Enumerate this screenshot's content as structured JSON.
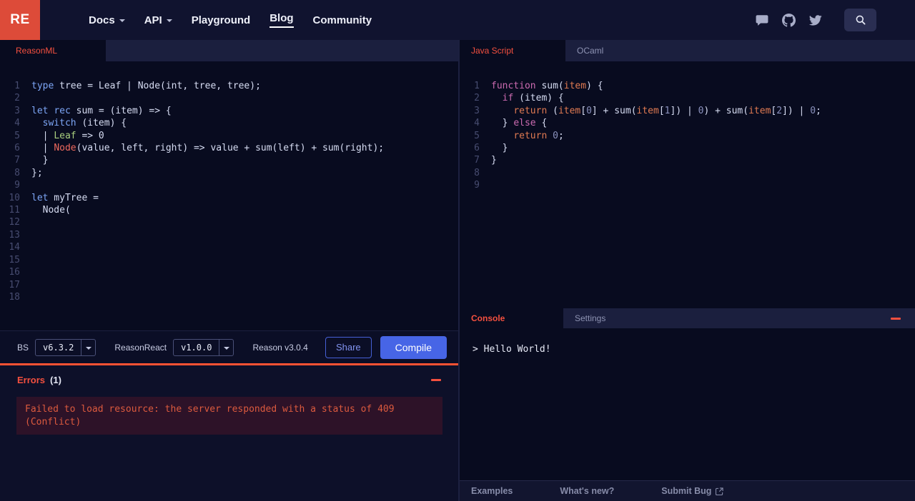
{
  "colors": {
    "accent_red": "#f4503f",
    "accent_blue": "#4765e6",
    "logo_red": "#dd4b39",
    "error_divider": "#ff5233"
  },
  "navbar": {
    "logo_text": "RE",
    "items": [
      {
        "label": "Docs",
        "caret": true
      },
      {
        "label": "API",
        "caret": true
      },
      {
        "label": "Playground",
        "caret": false
      },
      {
        "label": "Blog",
        "caret": false,
        "active": true
      },
      {
        "label": "Community",
        "caret": false
      }
    ],
    "icons": [
      "chat",
      "github",
      "twitter",
      "search"
    ]
  },
  "reason_editor": {
    "tab_label": "ReasonML",
    "code": [
      {
        "n": "1",
        "t": [
          [
            "k",
            "type"
          ],
          [
            "d",
            " tree = Leaf | Node(int, tree, tree);"
          ]
        ]
      },
      {
        "n": "2",
        "t": []
      },
      {
        "n": "3",
        "t": [
          [
            "k",
            "let"
          ],
          [
            "d",
            " "
          ],
          [
            "k",
            "rec"
          ],
          [
            "d",
            " sum = (item) => {"
          ]
        ]
      },
      {
        "n": "4",
        "t": [
          [
            "d",
            "  "
          ],
          [
            "k",
            "switch"
          ],
          [
            "d",
            " (item) {"
          ]
        ]
      },
      {
        "n": "5",
        "t": [
          [
            "d",
            "  | "
          ],
          [
            "g",
            "Leaf"
          ],
          [
            "d",
            " => 0"
          ]
        ]
      },
      {
        "n": "6",
        "t": [
          [
            "d",
            "  | "
          ],
          [
            "r",
            "Node"
          ],
          [
            "d",
            "(value, left, right) => value + sum(left) + sum(right);"
          ]
        ]
      },
      {
        "n": "7",
        "t": [
          [
            "d",
            "  }"
          ]
        ]
      },
      {
        "n": "8",
        "t": [
          [
            "d",
            "};"
          ]
        ]
      },
      {
        "n": "9",
        "t": []
      },
      {
        "n": "10",
        "t": [
          [
            "k",
            "let"
          ],
          [
            "d",
            " myTree ="
          ]
        ]
      },
      {
        "n": "11",
        "t": [
          [
            "d",
            "  Node("
          ]
        ]
      },
      {
        "n": "12",
        "t": []
      },
      {
        "n": "13",
        "t": []
      },
      {
        "n": "14",
        "t": []
      },
      {
        "n": "15",
        "t": []
      },
      {
        "n": "16",
        "t": []
      },
      {
        "n": "17",
        "t": []
      },
      {
        "n": "18",
        "t": []
      }
    ]
  },
  "js_editor": {
    "tabs": [
      {
        "label": "Java Script",
        "active": true
      },
      {
        "label": "OCaml",
        "active": false
      }
    ],
    "code": [
      {
        "n": "1",
        "t": [
          [
            "p",
            "function"
          ],
          [
            "d",
            " sum("
          ],
          [
            "o",
            "item"
          ],
          [
            "d",
            ") {"
          ]
        ]
      },
      {
        "n": "2",
        "t": [
          [
            "d",
            "  "
          ],
          [
            "p",
            "if"
          ],
          [
            "d",
            " (item) {"
          ]
        ]
      },
      {
        "n": "3",
        "t": [
          [
            "d",
            "    "
          ],
          [
            "o",
            "return"
          ],
          [
            "d",
            " ("
          ],
          [
            "o",
            "item"
          ],
          [
            "d",
            "["
          ],
          [
            "m",
            "0"
          ],
          [
            "d",
            "] + sum("
          ],
          [
            "o",
            "item"
          ],
          [
            "d",
            "["
          ],
          [
            "m",
            "1"
          ],
          [
            "d",
            "]) | "
          ],
          [
            "m",
            "0"
          ],
          [
            "d",
            ") + sum("
          ],
          [
            "o",
            "item"
          ],
          [
            "d",
            "["
          ],
          [
            "m",
            "2"
          ],
          [
            "d",
            "]) | "
          ],
          [
            "m",
            "0"
          ],
          [
            "d",
            ";"
          ]
        ]
      },
      {
        "n": "4",
        "t": [
          [
            "d",
            "  } "
          ],
          [
            "p",
            "else"
          ],
          [
            "d",
            " {"
          ]
        ]
      },
      {
        "n": "5",
        "t": [
          [
            "d",
            "    "
          ],
          [
            "o",
            "return"
          ],
          [
            "d",
            " "
          ],
          [
            "m",
            "0"
          ],
          [
            "d",
            ";"
          ]
        ]
      },
      {
        "n": "6",
        "t": [
          [
            "d",
            "  }"
          ]
        ]
      },
      {
        "n": "7",
        "t": [
          [
            "d",
            "}"
          ]
        ]
      },
      {
        "n": "8",
        "t": []
      },
      {
        "n": "9",
        "t": []
      }
    ]
  },
  "toolbar": {
    "bs_label": "BS",
    "bs_version": "v6.3.2",
    "reasonreact_label": "ReasonReact",
    "reasonreact_version": "v1.0.0",
    "reason_version": "Reason v3.0.4",
    "share_label": "Share",
    "compile_label": "Compile"
  },
  "errors": {
    "title": "Errors",
    "count": "(1)",
    "message": "Failed to load resource: the server responded with a status of 409 (Conflict)"
  },
  "console": {
    "tabs": [
      {
        "label": "Console",
        "active": true
      },
      {
        "label": "Settings",
        "active": false
      }
    ],
    "output": "> Hello World!"
  },
  "footer": {
    "links": [
      {
        "label": "Examples"
      },
      {
        "label": "What's new?"
      },
      {
        "label": "Submit Bug",
        "external": true
      }
    ]
  }
}
